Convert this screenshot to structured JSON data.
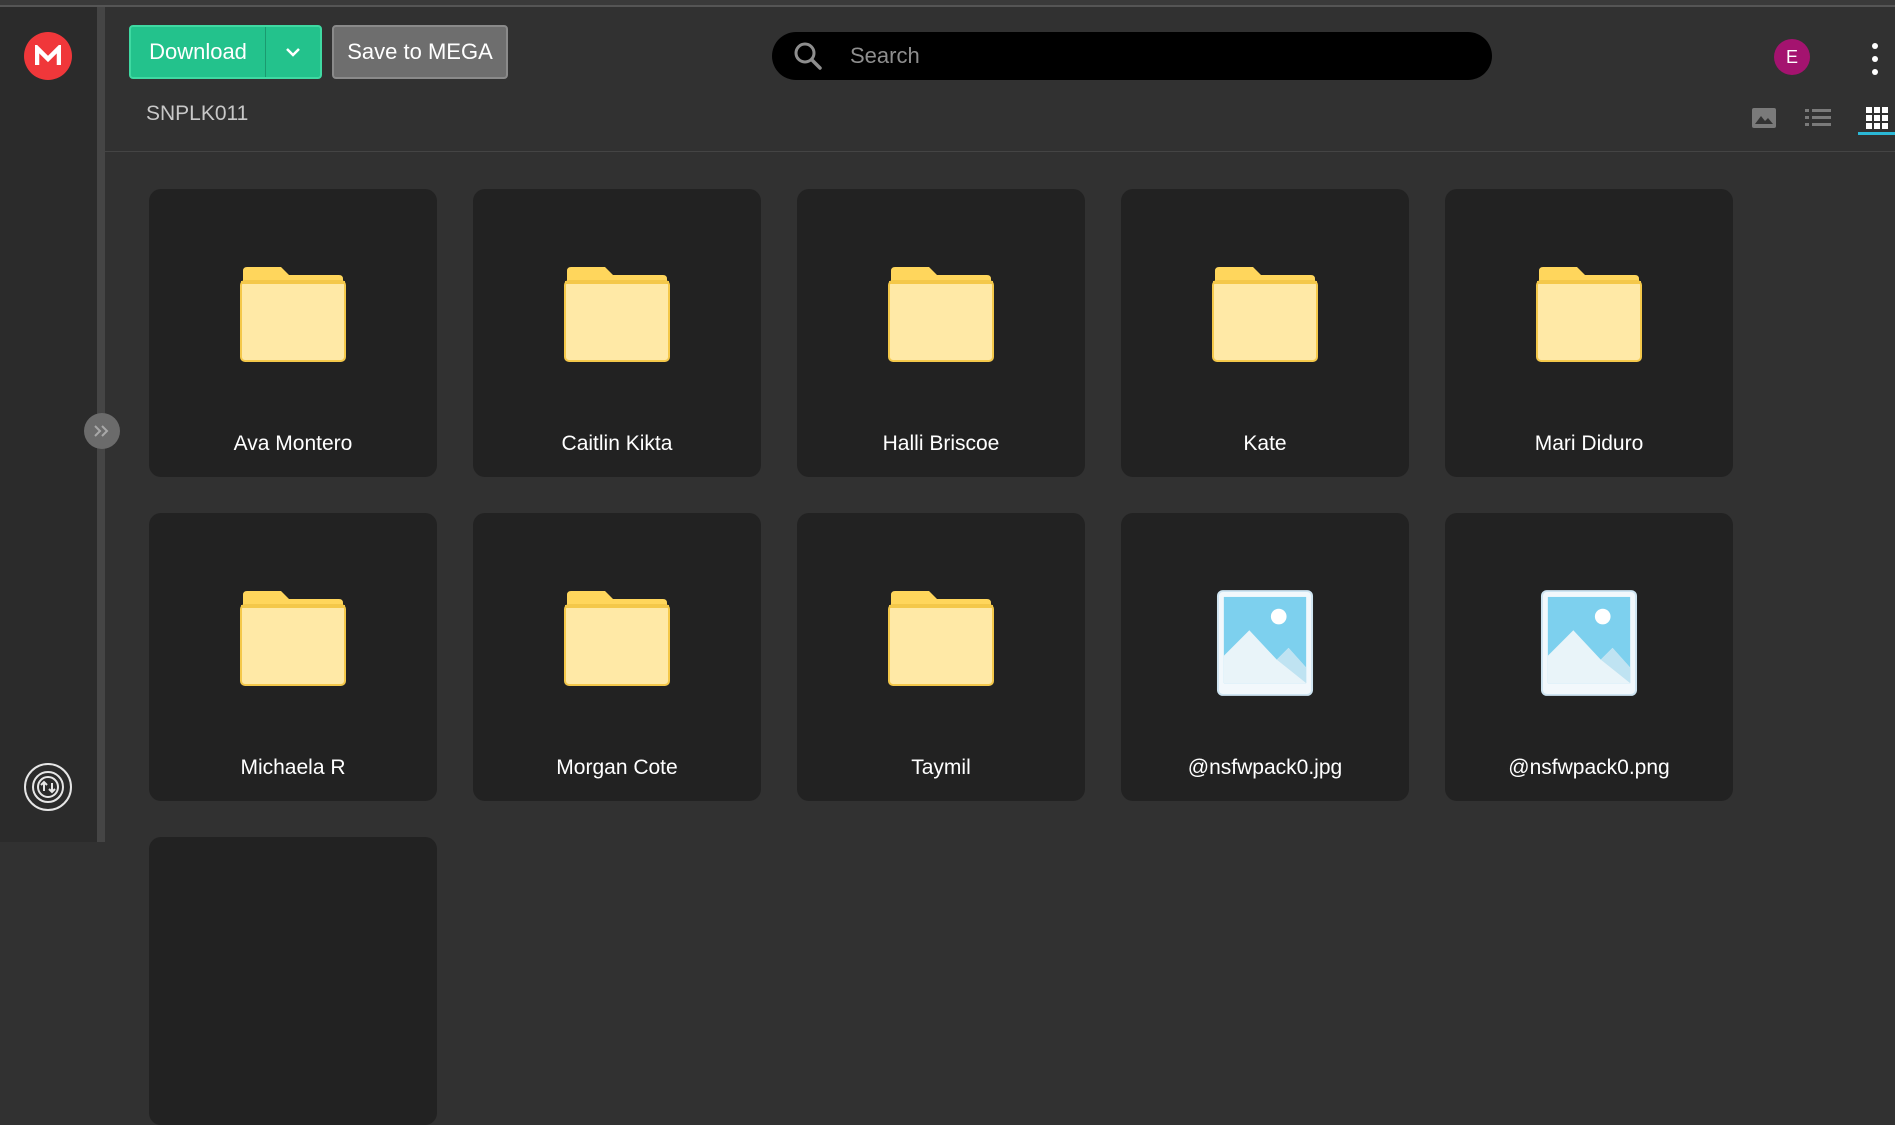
{
  "toolbar": {
    "download_label": "Download",
    "save_label": "Save to MEGA"
  },
  "search": {
    "placeholder": "Search"
  },
  "user": {
    "avatar_initial": "E"
  },
  "breadcrumb": {
    "folder": "SNPLK011"
  },
  "view_modes": [
    "thumbnail-view",
    "list-view",
    "grid-view"
  ],
  "active_view": "grid-view",
  "colors": {
    "accent_green": "#23c28c",
    "brand_red": "#f0373a",
    "avatar_purple": "#a4136f",
    "folder_yellow": "#ffe9a6",
    "active_tab_blue": "#2bb8d6"
  },
  "items": [
    {
      "name": "Ava Montero",
      "type": "folder"
    },
    {
      "name": "Caitlin Kikta",
      "type": "folder"
    },
    {
      "name": "Halli Briscoe",
      "type": "folder"
    },
    {
      "name": "Kate",
      "type": "folder"
    },
    {
      "name": "Mari Diduro",
      "type": "folder"
    },
    {
      "name": "Michaela R",
      "type": "folder"
    },
    {
      "name": "Morgan Cote",
      "type": "folder"
    },
    {
      "name": "Taymil",
      "type": "folder"
    },
    {
      "name": "@nsfwpack0.jpg",
      "type": "image"
    },
    {
      "name": "@nsfwpack0.png",
      "type": "image"
    }
  ]
}
